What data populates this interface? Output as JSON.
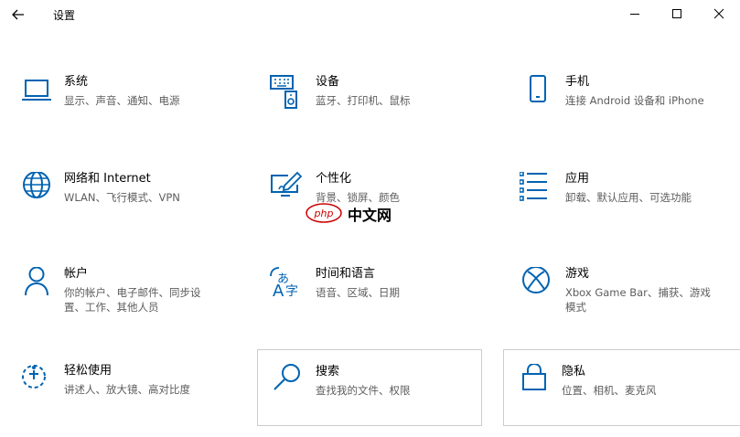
{
  "window": {
    "title": "设置"
  },
  "tiles": [
    {
      "name": "系统",
      "desc": "显示、声音、通知、电源"
    },
    {
      "name": "设备",
      "desc": "蓝牙、打印机、鼠标"
    },
    {
      "name": "手机",
      "desc": "连接 Android 设备和 iPhone"
    },
    {
      "name": "网络和 Internet",
      "desc": "WLAN、飞行模式、VPN"
    },
    {
      "name": "个性化",
      "desc": "背景、锁屏、颜色"
    },
    {
      "name": "应用",
      "desc": "卸载、默认应用、可选功能"
    },
    {
      "name": "帐户",
      "desc": "你的帐户、电子邮件、同步设置、工作、其他人员"
    },
    {
      "name": "时间和语言",
      "desc": "语音、区域、日期"
    },
    {
      "name": "游戏",
      "desc": "Xbox Game Bar、捕获、游戏模式"
    },
    {
      "name": "轻松使用",
      "desc": "讲述人、放大镜、高对比度"
    },
    {
      "name": "搜索",
      "desc": "查找我的文件、权限"
    },
    {
      "name": "隐私",
      "desc": "位置、相机、麦克风"
    }
  ],
  "watermark": {
    "badge": "php",
    "text": "中文网"
  },
  "colors": {
    "accent": "#0063b1",
    "desc_text": "#5d5d5d",
    "hover_border": "#cccccc"
  },
  "icons": [
    "back-arrow-icon",
    "minimize-icon",
    "maximize-icon",
    "close-icon",
    "laptop-icon",
    "keyboard-speaker-icon",
    "phone-icon",
    "globe-icon",
    "paint-monitor-icon",
    "apps-list-icon",
    "person-icon",
    "language-icon",
    "xbox-icon",
    "ease-of-access-icon",
    "search-icon",
    "lock-icon"
  ]
}
